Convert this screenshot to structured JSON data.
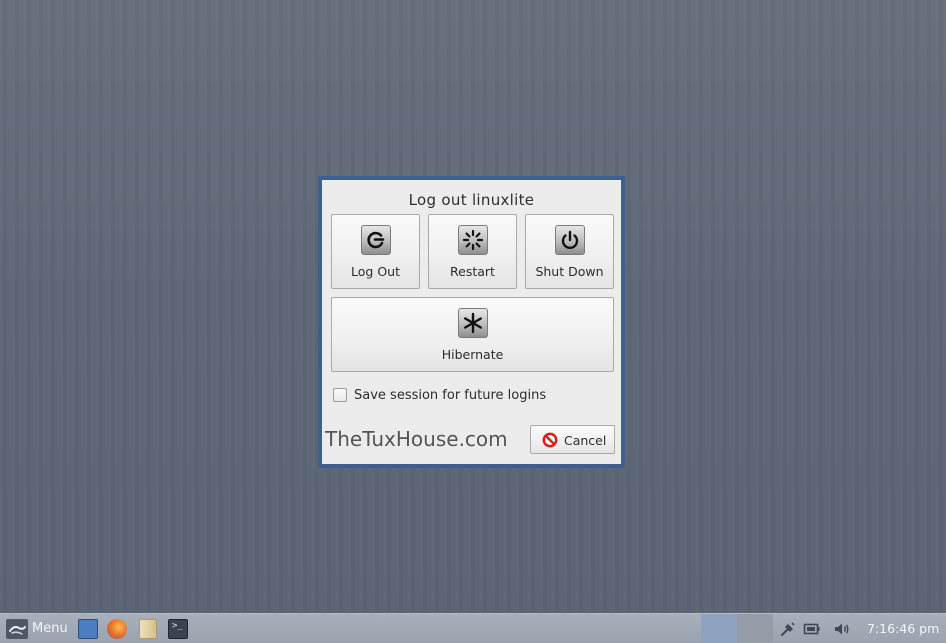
{
  "dialog": {
    "title": "Log out linuxlite",
    "actions": {
      "logout": {
        "label": "Log Out",
        "icon": "logout-icon"
      },
      "restart": {
        "label": "Restart",
        "icon": "restart-icon"
      },
      "shutdown": {
        "label": "Shut Down",
        "icon": "power-icon"
      },
      "hibernate": {
        "label": "Hibernate",
        "icon": "hibernate-icon"
      }
    },
    "save_session": {
      "label": "Save session for future logins",
      "checked": false
    },
    "watermark": "TheTuxHouse.com",
    "cancel": {
      "label": "Cancel",
      "icon": "cancel-icon"
    }
  },
  "taskbar": {
    "menu_label": "Menu",
    "launchers": [
      "show-desktop-icon",
      "firefox-icon",
      "file-manager-icon",
      "terminal-icon"
    ],
    "terminal_glyph": ">_",
    "tray": [
      "network-icon",
      "battery-icon",
      "volume-icon"
    ],
    "clock": "7:16:46 pm"
  },
  "colors": {
    "desktop": "#5f6977",
    "dialog_border": "#3f5f8f",
    "dialog_bg": "#ececec",
    "taskbar": "#9aa3af",
    "cancel_red": "#d81b1b"
  }
}
